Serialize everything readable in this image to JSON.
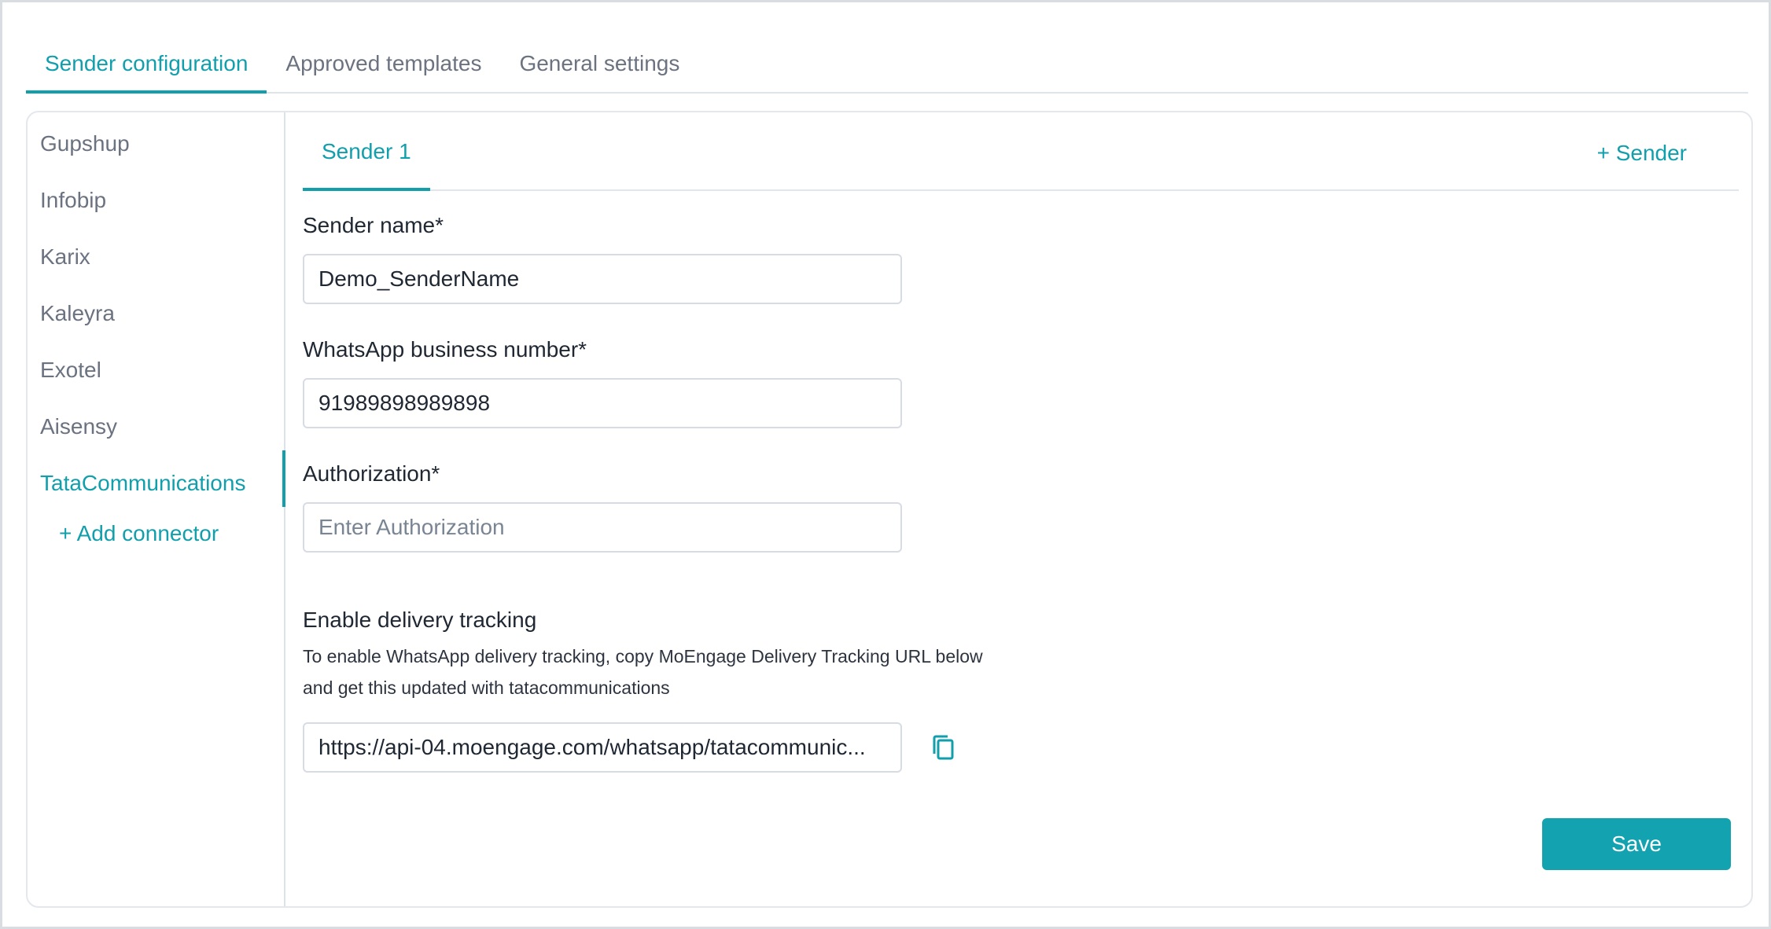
{
  "top_tabs": [
    {
      "label": "Sender configuration",
      "active": true
    },
    {
      "label": "Approved templates",
      "active": false
    },
    {
      "label": "General settings",
      "active": false
    }
  ],
  "sidebar": {
    "items": [
      {
        "label": "Gupshup"
      },
      {
        "label": "Infobip"
      },
      {
        "label": "Karix"
      },
      {
        "label": "Kaleyra"
      },
      {
        "label": "Exotel"
      },
      {
        "label": "Aisensy"
      },
      {
        "label": "TataCommunications",
        "active": true
      }
    ],
    "add_connector": "+ Add connector"
  },
  "sender_tabs": {
    "active_tab": "Sender 1",
    "add_sender": "+ Sender"
  },
  "form": {
    "sender_name": {
      "label": "Sender name*",
      "value": "Demo_SenderName"
    },
    "business_number": {
      "label": "WhatsApp business number*",
      "value": "91989898989898"
    },
    "authorization": {
      "label": "Authorization*",
      "value": "",
      "placeholder": "Enter Authorization"
    },
    "delivery_tracking": {
      "title": "Enable delivery tracking",
      "help_line1": "To enable WhatsApp delivery tracking, copy MoEngage Delivery Tracking URL below",
      "help_line2": "and get this updated with tatacommunications",
      "url": "https://api-04.moengage.com/whatsapp/tatacommunic..."
    }
  },
  "actions": {
    "save": "Save"
  },
  "icons": {
    "copy": "copy-icon"
  },
  "colors": {
    "accent": "#119fac",
    "save_button": "#12a2b0",
    "border": "#d7dce4",
    "muted_text": "#6b7280"
  }
}
